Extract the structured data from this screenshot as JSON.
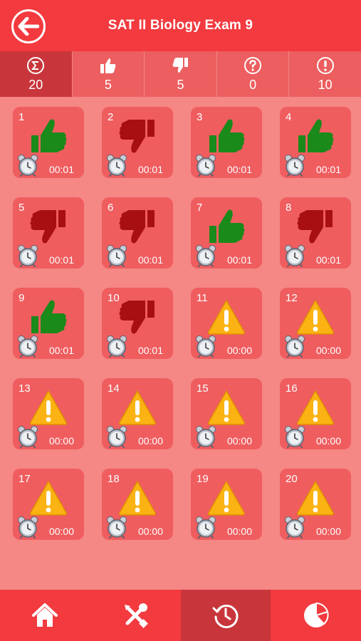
{
  "header": {
    "title": "SAT II Biology Exam 9",
    "back_icon": "back-arrow-icon"
  },
  "stats": [
    {
      "icon": "sigma-icon",
      "value": "20"
    },
    {
      "icon": "thumbs-up-icon",
      "value": "5"
    },
    {
      "icon": "thumbs-down-icon",
      "value": "5"
    },
    {
      "icon": "question-icon",
      "value": "0"
    },
    {
      "icon": "exclamation-icon",
      "value": "10"
    }
  ],
  "questions": [
    {
      "number": "1",
      "status": "correct",
      "time": "00:01"
    },
    {
      "number": "2",
      "status": "wrong",
      "time": "00:01"
    },
    {
      "number": "3",
      "status": "correct",
      "time": "00:01"
    },
    {
      "number": "4",
      "status": "correct",
      "time": "00:01"
    },
    {
      "number": "5",
      "status": "wrong",
      "time": "00:01"
    },
    {
      "number": "6",
      "status": "wrong",
      "time": "00:01"
    },
    {
      "number": "7",
      "status": "correct",
      "time": "00:01"
    },
    {
      "number": "8",
      "status": "wrong",
      "time": "00:01"
    },
    {
      "number": "9",
      "status": "correct",
      "time": "00:01"
    },
    {
      "number": "10",
      "status": "wrong",
      "time": "00:01"
    },
    {
      "number": "11",
      "status": "unanswered",
      "time": "00:00"
    },
    {
      "number": "12",
      "status": "unanswered",
      "time": "00:00"
    },
    {
      "number": "13",
      "status": "unanswered",
      "time": "00:00"
    },
    {
      "number": "14",
      "status": "unanswered",
      "time": "00:00"
    },
    {
      "number": "15",
      "status": "unanswered",
      "time": "00:00"
    },
    {
      "number": "16",
      "status": "unanswered",
      "time": "00:00"
    },
    {
      "number": "17",
      "status": "unanswered",
      "time": "00:00"
    },
    {
      "number": "18",
      "status": "unanswered",
      "time": "00:00"
    },
    {
      "number": "19",
      "status": "unanswered",
      "time": "00:00"
    },
    {
      "number": "20",
      "status": "unanswered",
      "time": "00:00"
    }
  ],
  "tabbar": {
    "tabs": [
      {
        "icon": "home-icon"
      },
      {
        "icon": "tools-icon"
      },
      {
        "icon": "history-icon",
        "active": true
      },
      {
        "icon": "pie-chart-icon"
      }
    ]
  },
  "colors": {
    "header": "#f23a3f",
    "background": "#f58785",
    "tile": "#ef5d5f",
    "correct": "#1a8a1a",
    "wrong": "#a80f12",
    "warning": "#fbb313"
  }
}
